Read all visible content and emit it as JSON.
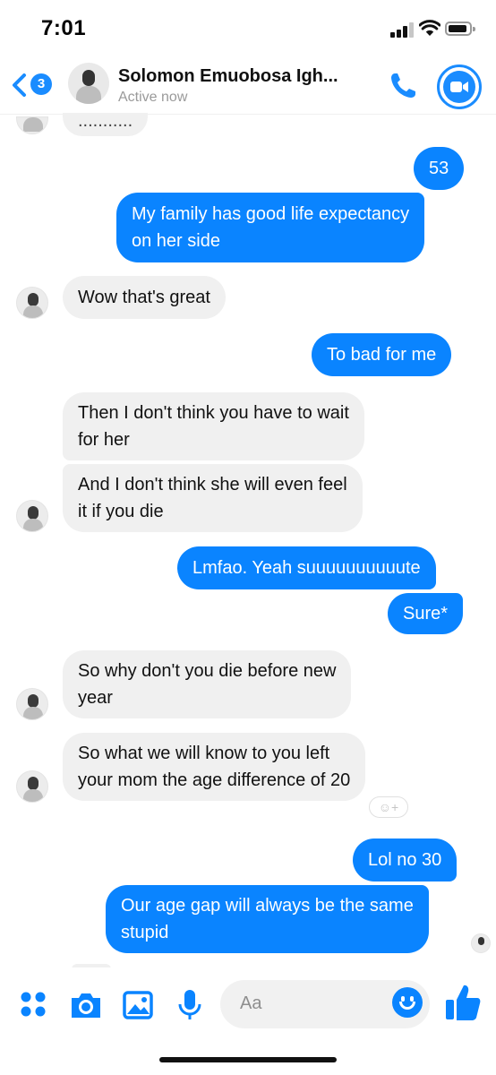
{
  "status_bar": {
    "time": "7:01"
  },
  "header": {
    "back_badge": "3",
    "contact_name": "Solomon Emuobosa Igh...",
    "contact_status": "Active now"
  },
  "messages": [
    {
      "side": "in",
      "text": [
        "..........."
      ]
    },
    {
      "side": "out",
      "text": [
        "53"
      ]
    },
    {
      "side": "out",
      "text": [
        "My family has good life expectancy",
        "on her side"
      ]
    },
    {
      "side": "in",
      "text": [
        "Wow that's great"
      ]
    },
    {
      "side": "out",
      "text": [
        "To bad for me"
      ]
    },
    {
      "side": "in",
      "text": [
        "Then I don't think you have to wait",
        "for her"
      ]
    },
    {
      "side": "in",
      "text": [
        "And I don't think she will even feel",
        "it if you die"
      ]
    },
    {
      "side": "out",
      "text": [
        "Lmfao. Yeah suuuuuuuuuute"
      ]
    },
    {
      "side": "out",
      "text": [
        "Sure*"
      ]
    },
    {
      "side": "in",
      "text": [
        "So why don't you die before new",
        "year"
      ]
    },
    {
      "side": "in",
      "text": [
        "So what we will know to you   left",
        "your mom the age difference of 20"
      ]
    },
    {
      "side": "out",
      "text": [
        "Lol no 30"
      ]
    },
    {
      "side": "out",
      "text": [
        "Our age gap will always be the same",
        "stupid"
      ]
    }
  ],
  "composer": {
    "placeholder": "Aa"
  },
  "icons": {
    "back": "chevron-left-icon",
    "call": "phone-icon",
    "video": "video-camera-icon",
    "apps": "four-dots-icon",
    "camera": "camera-icon",
    "gallery": "image-icon",
    "mic": "microphone-icon",
    "emoji": "emoji-icon",
    "like": "thumbs-up-icon",
    "react": "add-reaction-icon"
  },
  "colors": {
    "accent": "#0a84ff",
    "incoming_bubble": "#f0f0f0",
    "outgoing_text": "#ffffff"
  }
}
